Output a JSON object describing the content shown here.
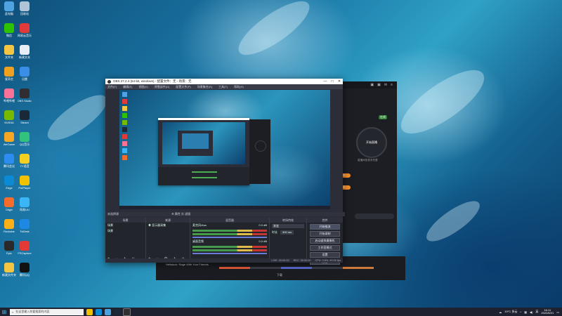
{
  "obs": {
    "title": "OBS 27.2.4 (64-bit, windows) - 配置文件：无 - 场景：无",
    "window_controls": [
      "—",
      "□",
      "✕"
    ],
    "menu": [
      "文件(F)",
      "编辑(E)",
      "视图(V)",
      "停靠部件(D)",
      "配置文件(P)",
      "场景集合(S)",
      "工具(T)",
      "帮助(H)"
    ],
    "scene_bar_label": "未选择源",
    "scene_bar_tools": "⚙ 属性  ▦ 滤镜",
    "docks": {
      "scenes": {
        "header": "场景",
        "items": [
          "场景",
          "场景"
        ],
        "footer": "+ − ∧ ∨"
      },
      "sources": {
        "header": "来源",
        "items": [
          "显示器采集"
        ],
        "footer": "+ − ⚙ ∧ ∨"
      },
      "mixer": {
        "header": "混音器",
        "channels": [
          {
            "name": "麦克风/Aux",
            "level": "0.0 dB"
          },
          {
            "name": "桌面音频",
            "level": "0.0 dB"
          }
        ]
      },
      "transitions": {
        "header": "转场特效",
        "type": "渐变",
        "duration_label": "时长",
        "duration": "300 ms"
      },
      "controls": {
        "header": "控件",
        "buttons": [
          "开始推流",
          "开始录制",
          "启动虚拟摄像机",
          "工作室模式",
          "设置",
          "退出"
        ]
      }
    },
    "status": [
      "LIVE: 00:00:00",
      "REC: 00:00:00",
      "CPU: 0.8%, 60.00 fps"
    ]
  },
  "app2": {
    "badge": "在线",
    "center_label": "开始直播",
    "info": "直播间信息未完善",
    "orange_tags": [
      "标签",
      "标签"
    ]
  },
  "app3": {
    "title": "Hellstuck: Rage With Your Friends",
    "bottom_label": "下载"
  },
  "taskbar": {
    "search_placeholder": "在这里输入你要搜索的内容",
    "weather": "19°C 多云",
    "lang": "英",
    "time": "16:11",
    "date": "2022/6/21"
  },
  "desktop_icons": [
    {
      "label": "此电脑",
      "color": "#4fa3e0"
    },
    {
      "label": "回收站",
      "color": "#b0c4d8"
    },
    {
      "label": "微信",
      "color": "#2dc100"
    },
    {
      "label": "网易云音乐",
      "color": "#e03a3a"
    },
    {
      "label": "文件夹",
      "color": "#f4c542"
    },
    {
      "label": "新建文本",
      "color": "#e8eef5"
    },
    {
      "label": "爱奇艺",
      "color": "#f0a020"
    },
    {
      "label": "迅雷",
      "color": "#3a8ee6"
    },
    {
      "label": "哔哩哔哩",
      "color": "#fb7299"
    },
    {
      "label": "OBS Studio",
      "color": "#302e31"
    },
    {
      "label": "NVIDIA",
      "color": "#76b900"
    },
    {
      "label": "Steam",
      "color": "#1b2838"
    },
    {
      "label": "WeGame",
      "color": "#f5a623"
    },
    {
      "label": "QQ音乐",
      "color": "#31c27c"
    },
    {
      "label": "腾讯会议",
      "color": "#2d8cf0"
    },
    {
      "label": "YY语音",
      "color": "#f5d020"
    },
    {
      "label": "Edge",
      "color": "#0c8bd4"
    },
    {
      "label": "PotPlayer",
      "color": "#f2c200"
    },
    {
      "label": "Origin",
      "color": "#f56c2d"
    },
    {
      "label": "网易UU",
      "color": "#3bb5f5"
    },
    {
      "label": "Rockstar",
      "color": "#fcaf17"
    },
    {
      "label": "ToDesk",
      "color": "#1e88e5"
    },
    {
      "label": "Epic",
      "color": "#2a2a2a"
    },
    {
      "label": "FSCapture",
      "color": "#e53935"
    },
    {
      "label": "新建文件夹",
      "color": "#f4c542"
    },
    {
      "label": "腾讯QQ",
      "color": "#111111"
    }
  ]
}
